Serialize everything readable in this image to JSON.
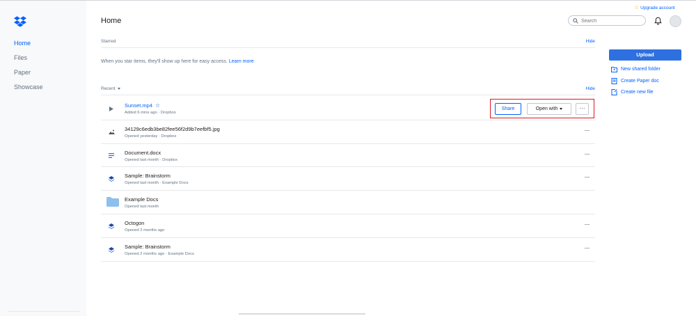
{
  "sidebar": {
    "items": [
      {
        "label": "Home",
        "active": true
      },
      {
        "label": "Files",
        "active": false
      },
      {
        "label": "Paper",
        "active": false
      },
      {
        "label": "Showcase",
        "active": false
      }
    ]
  },
  "header": {
    "title": "Home",
    "upgrade_label": "Upgrade account",
    "search_placeholder": "Search"
  },
  "starred": {
    "label": "Starred",
    "hide_label": "Hide",
    "message": "When you star items, they'll show up here for easy access.",
    "learn_more": "Learn more"
  },
  "recent": {
    "label": "Recent",
    "hide_label": "Hide",
    "rows": [
      {
        "name": "Sunset.mp4",
        "meta": "Added 6 mins ago · Dropbox",
        "icon": "play-icon",
        "starred": true
      },
      {
        "name": "34129c6edb3be82fee56f2d9b7eefbf5.jpg",
        "meta": "Opened yesterday · Dropbox",
        "icon": "image-icon"
      },
      {
        "name": "Document.docx",
        "meta": "Opened last month · Dropbox",
        "icon": "document-icon"
      },
      {
        "name": "Sample: Brainstorm",
        "meta": "Opened last month · Example Docs",
        "icon": "paper-icon"
      },
      {
        "name": "Example Docs",
        "meta": "Opened last month",
        "icon": "folder-icon"
      },
      {
        "name": "Octogon",
        "meta": "Opened 2 months ago",
        "icon": "paper-icon"
      },
      {
        "name": "Sample: Brainstorm",
        "meta": "Opened 2 months ago · Example Docs",
        "icon": "paper-icon"
      }
    ],
    "actions": {
      "share_label": "Share",
      "open_with_label": "Open with",
      "more_label": "···"
    }
  },
  "right_panel": {
    "upload_label": "Upload",
    "actions": [
      {
        "label": "New shared folder",
        "icon": "shared-folder-icon"
      },
      {
        "label": "Create Paper doc",
        "icon": "paper-doc-icon"
      },
      {
        "label": "Create new file",
        "icon": "new-file-icon"
      }
    ]
  },
  "colors": {
    "accent": "#0061fe",
    "upload_bg": "#2e70e0",
    "highlight_border": "#d71920",
    "star_yellow": "#f4b400"
  }
}
